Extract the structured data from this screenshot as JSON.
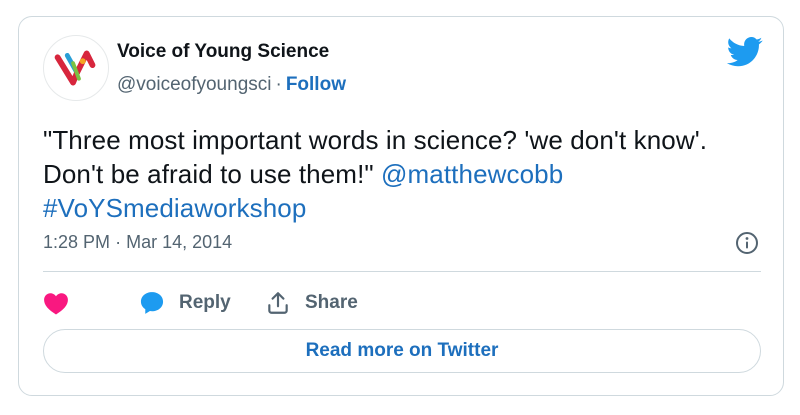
{
  "colors": {
    "link": "#1d6fbd",
    "twitter_blue": "#1d9bf0",
    "heart": "#f91880",
    "text": "#0f1419",
    "muted": "#536471",
    "border": "#cfd9de"
  },
  "author": {
    "display_name": "Voice of Young Science",
    "handle": "@voiceofyoungsci",
    "separator": "·",
    "follow_label": "Follow",
    "avatar_icon": "voys-logo-icon"
  },
  "header": {
    "logo_icon": "twitter-bird-icon"
  },
  "tweet": {
    "text_line1": "\"Three most important words in science? 'we don't know'.",
    "text_line2": "Don't be afraid to use them!\"",
    "mention": "@matthewcobb",
    "hashtag": "#VoYSmediaworkshop",
    "time": "1:28 PM",
    "separator": "·",
    "date": "Mar 14, 2014",
    "info_icon": "info-icon"
  },
  "actions": {
    "like_icon": "heart-icon",
    "reply_label": "Reply",
    "reply_icon": "speech-bubble-icon",
    "share_label": "Share",
    "share_icon": "share-icon"
  },
  "footer": {
    "read_more_label": "Read more on Twitter"
  }
}
